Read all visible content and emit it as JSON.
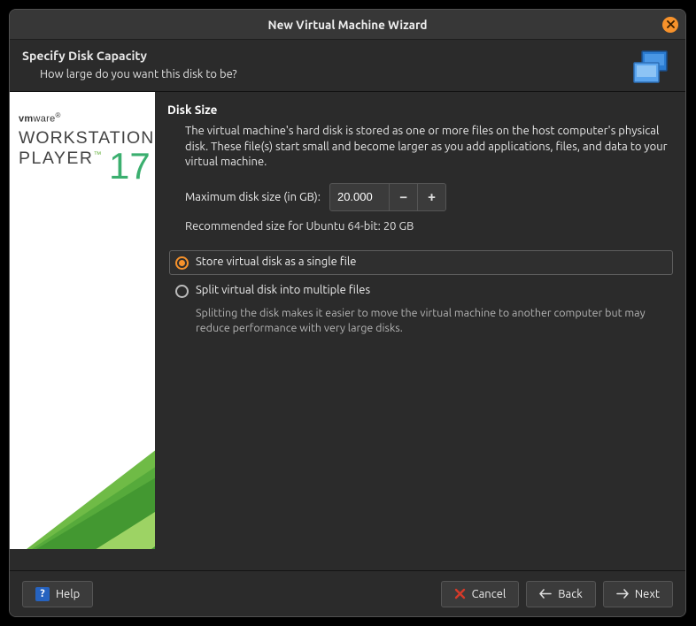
{
  "window": {
    "title": "New Virtual Machine Wizard"
  },
  "header": {
    "title": "Specify Disk Capacity",
    "subtitle": "How large do you want this disk to be?"
  },
  "banner": {
    "brand": "vmware",
    "product_line1": "WORKSTATION",
    "product_line2": "PLAYER",
    "version": "17"
  },
  "content": {
    "section_title": "Disk Size",
    "description": "The virtual machine's hard disk is stored as one or more files on the host computer's physical disk. These file(s) start small and become larger as you add applications, files, and data to your virtual machine.",
    "max_label": "Maximum disk size (in GB):",
    "max_value": "20.000",
    "recommend": "Recommended size for Ubuntu 64-bit: 20 GB",
    "radio": {
      "single": "Store virtual disk as a single file",
      "split": "Split virtual disk into multiple files",
      "split_desc": "Splitting the disk makes it easier to move the virtual machine to another computer but may reduce performance with very large disks.",
      "selected": "single"
    }
  },
  "footer": {
    "help": "Help",
    "cancel": "Cancel",
    "back": "Back",
    "next": "Next"
  }
}
